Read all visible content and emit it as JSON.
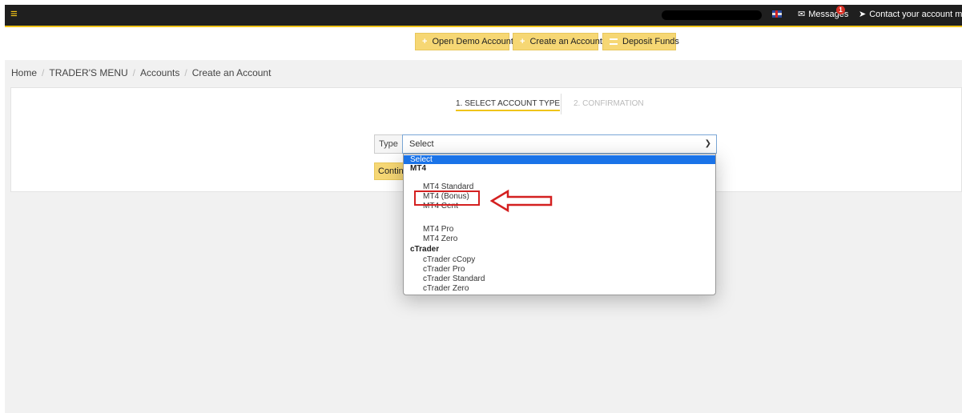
{
  "topbar": {
    "messages_label": "Messages",
    "messages_badge": "1",
    "contact_label": "Contact your account manage"
  },
  "actions": {
    "open_demo": "Open Demo Account",
    "create_account": "Create an Account",
    "deposit": "Deposit Funds"
  },
  "breadcrumb": [
    "Home",
    "TRADER'S MENU",
    "Accounts",
    "Create an Account"
  ],
  "steps": {
    "step1": "1. SELECT ACCOUNT TYPE",
    "step2": "2. CONFIRMATION"
  },
  "form": {
    "type_label": "Type",
    "select_value": "Select",
    "continue_label": "Contin"
  },
  "dropdown": {
    "options": [
      {
        "label": "Select",
        "kind": "selected"
      },
      {
        "label": "MT4",
        "kind": "group"
      },
      {
        "label": "MT4 Standard",
        "kind": "item"
      },
      {
        "label": "MT4 (Bonus)",
        "kind": "item"
      },
      {
        "label": "MT4 Cent",
        "kind": "item"
      },
      {
        "label": "MT4 Pro",
        "kind": "item"
      },
      {
        "label": "MT4 Zero",
        "kind": "item"
      },
      {
        "label": "cTrader",
        "kind": "group"
      },
      {
        "label": "cTrader cCopy",
        "kind": "item"
      },
      {
        "label": "cTrader Pro",
        "kind": "item"
      },
      {
        "label": "cTrader Standard",
        "kind": "item"
      },
      {
        "label": "cTrader Zero",
        "kind": "item"
      }
    ],
    "highlighted_option": "MT4 (Bonus)"
  },
  "colors": {
    "accent": "#f6d774",
    "topbar": "#1f1f1f",
    "annotation": "#d42020",
    "selected_option": "#1a73e8"
  }
}
